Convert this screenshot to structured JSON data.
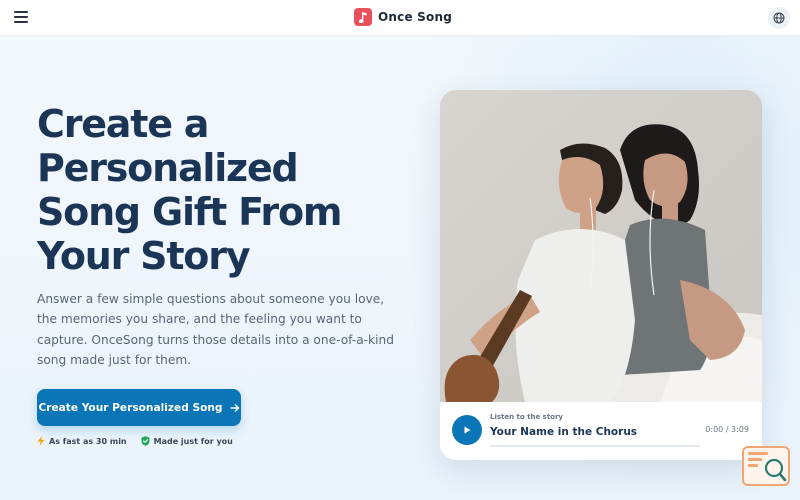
{
  "header": {
    "menu_icon": "hamburger-menu-icon",
    "brand_name": "Once Song",
    "brand_icon": "music-note-icon",
    "brand_color": "#e8505b",
    "language_icon": "globe-icon"
  },
  "hero": {
    "headline": "Create a Personalized Song Gift From Your Story",
    "description": "Answer a few simple questions about someone you love, the memories you share, and the feeling you want to capture. OnceSong turns those details into a one-of-a-kind song made just for them.",
    "cta_label": "Create Your Personalized Song",
    "cta_icon": "arrow-right-icon",
    "accent_color": "#0a76b8",
    "badges": [
      {
        "icon": "lightning-icon",
        "label": "As fast as 30 min"
      },
      {
        "icon": "shield-check-icon",
        "label": "Made just for you"
      }
    ]
  },
  "player": {
    "eyebrow": "Listen to the story",
    "title": "Your Name in the Chorus",
    "time": "0:00 / 3:09",
    "progress": 0,
    "play_icon": "play-icon"
  },
  "corner_widget_icon": "search-icon"
}
